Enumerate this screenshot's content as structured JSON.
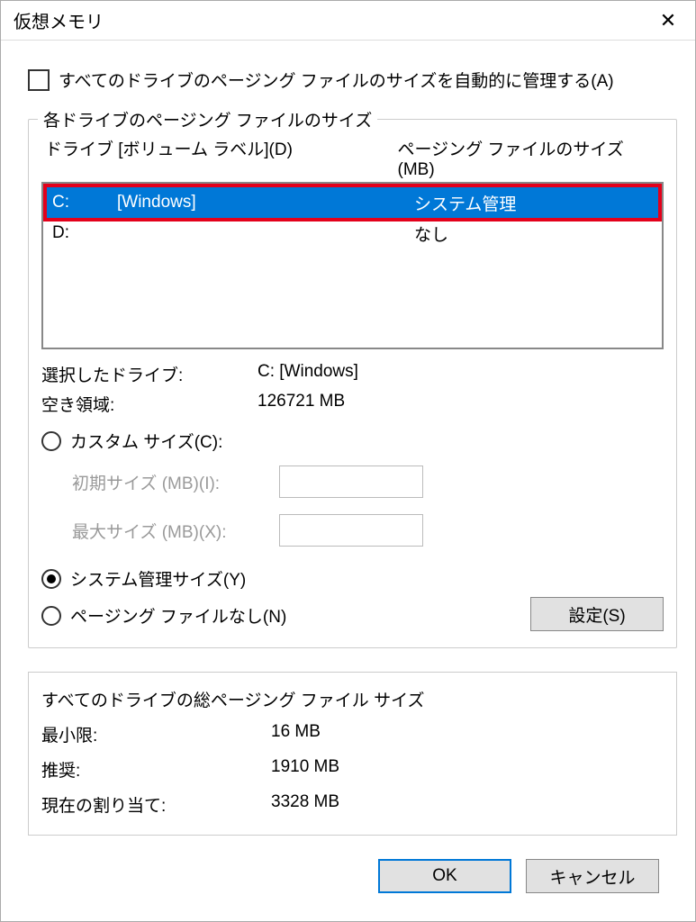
{
  "window": {
    "title": "仮想メモリ"
  },
  "auto_manage": {
    "label": "すべてのドライブのページング ファイルのサイズを自動的に管理する(A)"
  },
  "drives_group": {
    "legend": "各ドライブのページング ファイルのサイズ",
    "col_drive": "ドライブ  [ボリューム ラベル](D)",
    "col_size": "ページング ファイルのサイズ (MB)",
    "rows": [
      {
        "drive": "C:",
        "label": "[Windows]",
        "size": "システム管理",
        "selected": true
      },
      {
        "drive": "D:",
        "label": "",
        "size": "なし",
        "selected": false
      }
    ],
    "selected_drive_label": "選択したドライブ:",
    "selected_drive_value": "C:  [Windows]",
    "free_space_label": "空き領域:",
    "free_space_value": "126721 MB",
    "custom_size": "カスタム サイズ(C):",
    "initial_size": "初期サイズ (MB)(I):",
    "max_size": "最大サイズ (MB)(X):",
    "system_managed": "システム管理サイズ(Y)",
    "no_paging": "ページング ファイルなし(N)",
    "set_button": "設定(S)"
  },
  "total_group": {
    "legend": "すべてのドライブの総ページング ファイル サイズ",
    "min_label": "最小限:",
    "min_value": "16 MB",
    "rec_label": "推奨:",
    "rec_value": "1910 MB",
    "cur_label": "現在の割り当て:",
    "cur_value": "3328 MB"
  },
  "buttons": {
    "ok": "OK",
    "cancel": "キャンセル"
  }
}
